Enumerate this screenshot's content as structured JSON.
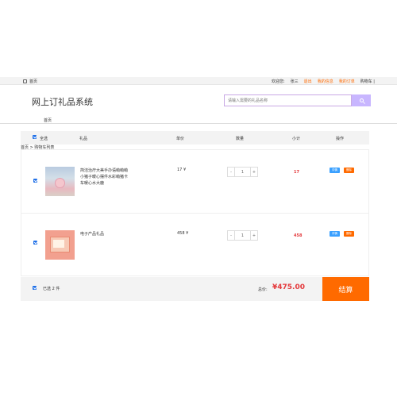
{
  "topbar": {
    "home": "首页",
    "welcome": "欢迎您:",
    "user": "张三",
    "logout": "退出",
    "my_info": "我的信息",
    "my_orders": "我的订单",
    "cart": "购物车 |"
  },
  "header": {
    "logo": "网上订礼品系统",
    "search_placeholder": "请输入需要的礼品名称",
    "nav_home": "首页"
  },
  "table": {
    "headers": {
      "select_all": "全选",
      "gift": "礼品",
      "unit_price": "单价",
      "quantity": "数量",
      "subtotal": "小计",
      "actions": "操作"
    }
  },
  "breadcrumb": "首页 > 购物车列表",
  "cart_items": [
    {
      "name": "简洁治疗大美手办语萌萌萌小猪子暖心摆件水彩萌猪卡车暖心水大鹿",
      "price": "17 ¥",
      "quantity": "1",
      "subtotal": "17",
      "detail_label": "详情",
      "delete_label": "删除"
    },
    {
      "name": "电子产品礼品",
      "price": "458 ¥",
      "quantity": "1",
      "subtotal": "458",
      "detail_label": "详情",
      "delete_label": "删除"
    }
  ],
  "footer": {
    "selected": "已选 2 件",
    "total_label": "总价:",
    "total": "¥475.00",
    "checkout": "结算"
  },
  "qty_controls": {
    "minus": "-",
    "plus": "+"
  },
  "colors": {
    "accent": "#ff6a00",
    "price_red": "#e4393c",
    "search_btn": "#c8b6ff",
    "detail_btn": "#3aa0ff"
  }
}
